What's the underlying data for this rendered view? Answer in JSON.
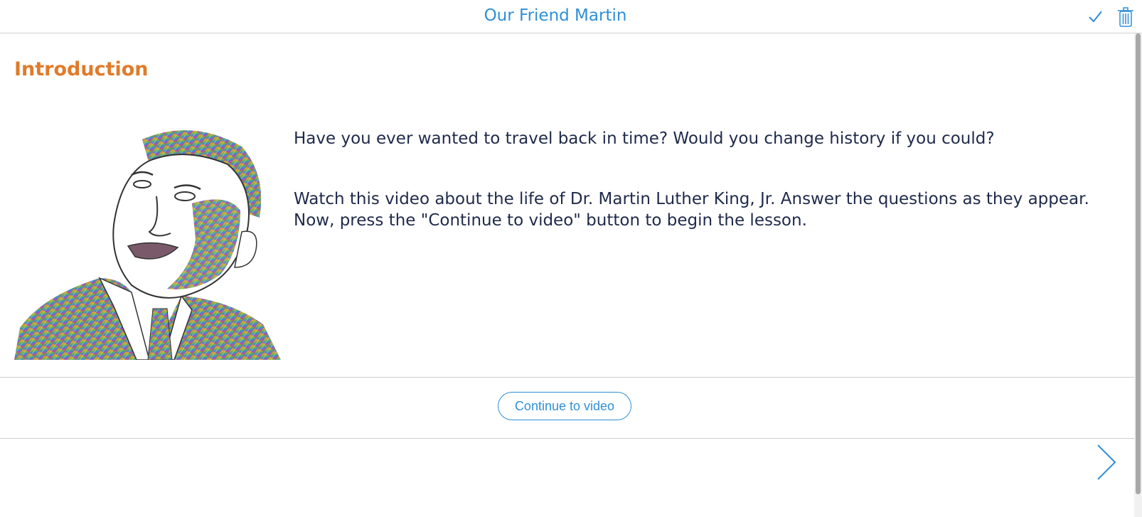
{
  "header": {
    "title": "Our Friend Martin",
    "check_icon": "checkmark-icon",
    "trash_icon": "trash-icon"
  },
  "main": {
    "section_title": "Introduction",
    "paragraphs": [
      "Have you ever wanted to travel back in time? Would you change history if you could?",
      "Watch this video about the life of Dr. Martin Luther King, Jr. Answer the questions as they appear.",
      "Now, press the \"Continue to video\" button to begin the lesson."
    ]
  },
  "footer": {
    "continue_label": "Continue to video",
    "next_icon": "chevron-right-icon"
  },
  "colors": {
    "accent": "#2f8fd6",
    "heading": "#e07b2a",
    "text": "#1f2a4a"
  }
}
